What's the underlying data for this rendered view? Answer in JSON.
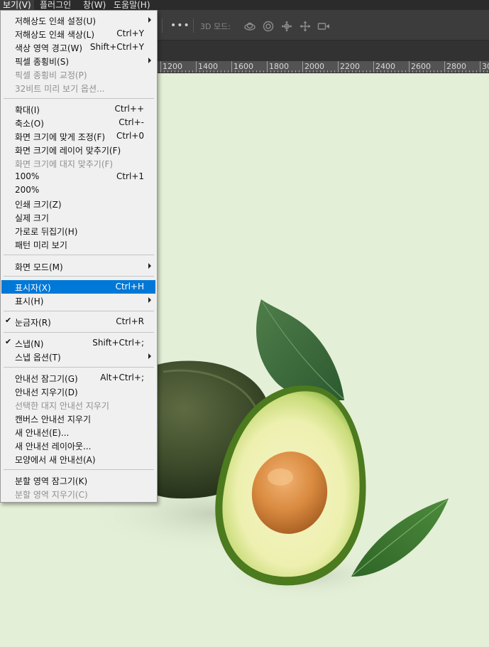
{
  "menubar": {
    "items": [
      {
        "label": "보기(V)",
        "active": true
      },
      {
        "label": "플러그인",
        "active": false
      },
      {
        "label": "창(W)",
        "active": false
      },
      {
        "label": "도움말(H)",
        "active": false
      }
    ]
  },
  "options_bar": {
    "more_glyph": "•••",
    "mode_3d_label": "3D 모드:",
    "icons": [
      "orbit-3d-icon",
      "roll-3d-icon",
      "pan-3d-icon",
      "slide-3d-icon",
      "video-camera-3d-icon"
    ]
  },
  "ruler": {
    "labels": [
      "1200",
      "1400",
      "1600",
      "1800",
      "2000",
      "2200",
      "2400",
      "2600",
      "2800",
      "30"
    ]
  },
  "view_menu": {
    "items": [
      {
        "label": "저해상도 인쇄 설정(U)",
        "submenu": true
      },
      {
        "label": "저해상도 인쇄 색상(L)",
        "shortcut": "Ctrl+Y"
      },
      {
        "label": "색상 영역 경고(W)",
        "shortcut": "Shift+Ctrl+Y"
      },
      {
        "label": "픽셀 종횡비(S)",
        "submenu": true
      },
      {
        "label": "픽셀 종횡비 교정(P)",
        "disabled": true
      },
      {
        "label": "32비트 미리 보기 옵션...",
        "disabled": true
      },
      {
        "label": "확대(I)",
        "shortcut": "Ctrl++"
      },
      {
        "label": "축소(O)",
        "shortcut": "Ctrl+-"
      },
      {
        "label": "화면 크기에 맞게 조정(F)",
        "shortcut": "Ctrl+0"
      },
      {
        "label": "화면 크기에 레이어 맞추기(F)"
      },
      {
        "label": "화면 크기에 대지 맞추기(F)",
        "disabled": true
      },
      {
        "label": "100%",
        "shortcut": "Ctrl+1"
      },
      {
        "label": "200%"
      },
      {
        "label": "인쇄 크기(Z)"
      },
      {
        "label": "실제 크기"
      },
      {
        "label": "가로로 뒤집기(H)"
      },
      {
        "label": "패턴 미리 보기"
      },
      {
        "label": "화면 모드(M)",
        "submenu": true
      },
      {
        "label": "표시자(X)",
        "shortcut": "Ctrl+H",
        "highlighted": true
      },
      {
        "label": "표시(H)",
        "submenu": true
      },
      {
        "label": "눈금자(R)",
        "shortcut": "Ctrl+R",
        "checked": true
      },
      {
        "label": "스냅(N)",
        "shortcut": "Shift+Ctrl+;",
        "checked": true
      },
      {
        "label": "스냅 옵션(T)",
        "submenu": true
      },
      {
        "label": "안내선 잠그기(G)",
        "shortcut": "Alt+Ctrl+;"
      },
      {
        "label": "안내선 지우기(D)"
      },
      {
        "label": "선택한 대지 안내선 지우기",
        "disabled": true
      },
      {
        "label": "캔버스 안내선 지우기"
      },
      {
        "label": "새 안내선(E)..."
      },
      {
        "label": "새 안내선 레이아웃..."
      },
      {
        "label": "모양에서 새 안내선(A)"
      },
      {
        "label": "분할 영역 잠그기(K)"
      },
      {
        "label": "분할 영역 지우기(C)",
        "disabled": true
      }
    ],
    "check_glyph": "✔"
  },
  "colors": {
    "canvas_bg": "#e3efd6",
    "menu_highlight": "#0078d7",
    "menubar_bg": "#2b2b2b"
  }
}
